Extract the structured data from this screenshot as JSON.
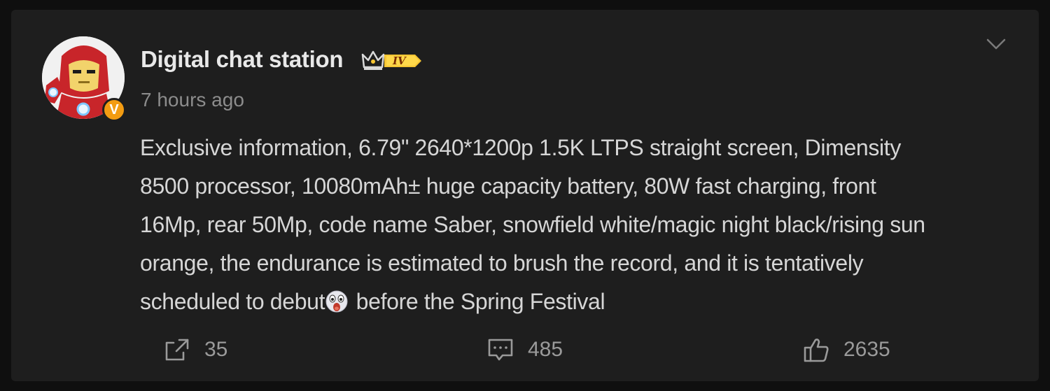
{
  "post": {
    "author": "Digital chat station",
    "level": "IV",
    "timestamp": "7 hours ago",
    "verified_mark": "V",
    "body_lines": [
      "Exclusive information, 6.79\" 2640*1200p 1.5K LTPS straight screen, Dimensity",
      "8500 processor, 10080mAh± huge capacity battery, 80W fast charging, front",
      "16Mp, rear 50Mp, code name Saber, snowfield white/magic night black/rising sun",
      "orange, the endurance is estimated to brush the record, and it is tentatively"
    ],
    "body_last_before_emoji": "scheduled to debut",
    "body_last_after_emoji": " before the Spring Festival",
    "emoji": "surprised-face-emoji"
  },
  "actions": {
    "shares": "35",
    "comments": "485",
    "likes": "2635"
  },
  "colors": {
    "background": "#0f0f0f",
    "card": "#1e1e1e",
    "name_text": "#e8e8e8",
    "body_text": "#d6d6d6",
    "muted_text": "#8c8c8c",
    "verified_badge": "#f39c12",
    "level_badge": "#f6c533"
  },
  "icons": {
    "share": "share-icon",
    "comment": "comment-icon",
    "like": "thumbs-up-icon",
    "menu": "chevron-down-icon",
    "crown": "crown-icon"
  }
}
